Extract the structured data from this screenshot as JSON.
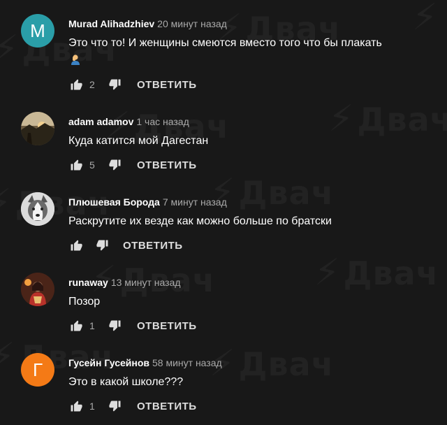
{
  "watermark_text": "Двач",
  "reply_label": "ОТВЕТИТЬ",
  "comments": [
    {
      "author": "Murad Alihadzhiev",
      "time": "20 минут назад",
      "text": "Это что то! И женщины смеются вместо того что бы плакать",
      "likes": "2",
      "avatar_letter": "M",
      "avatar_color": "#2a9ea8"
    },
    {
      "author": "adam adamov",
      "time": "1 час назад",
      "text": "Куда катится мой Дагестан",
      "likes": "5",
      "avatar_letter": "",
      "avatar_color": "#3a3326"
    },
    {
      "author": "Плюшевая Борода",
      "time": "7 минут назад",
      "text": "Раскрутите их везде как можно больше по братски",
      "likes": "",
      "avatar_letter": "",
      "avatar_color": "#e8e8e8"
    },
    {
      "author": "runaway",
      "time": "13 минут назад",
      "text": "Позор",
      "likes": "1",
      "avatar_letter": "",
      "avatar_color": "#3a1a14"
    },
    {
      "author": "Гусейн Гусейнов",
      "time": "58 минут назад",
      "text": "Это в какой школе???",
      "likes": "1",
      "avatar_letter": "Г",
      "avatar_color": "#f47a16"
    }
  ]
}
